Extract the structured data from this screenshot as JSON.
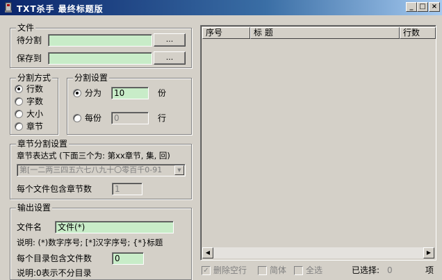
{
  "window": {
    "title": "TXT杀手  最终标题版",
    "minimize": "_",
    "maximize": "□",
    "close": "×"
  },
  "file": {
    "legend": "文件",
    "source_label": "待分割",
    "source_value": "",
    "save_label": "保存到",
    "save_value": "",
    "browse_label": "...",
    "browse2_label": "..."
  },
  "split_mode": {
    "legend": "分割方式",
    "options": [
      "行数",
      "字数",
      "大小",
      "章节"
    ],
    "selected": "行数"
  },
  "split_settings": {
    "legend": "分割设置",
    "parts_label": "分为",
    "parts_value": "10",
    "parts_unit": "份",
    "lines_label": "每份",
    "lines_value": "0",
    "lines_unit": "行"
  },
  "chapter": {
    "legend": "章节分割设置",
    "expr_label": "章节表达式 (下面三个为: 第xx章节, 集, 回)",
    "expr_value": "第[一二两三四五六七八九十〇零百千0-91",
    "per_file_label": "每个文件包含章节数",
    "per_file_value": "1"
  },
  "output": {
    "legend": "输出设置",
    "filename_label": "文件名",
    "filename_value": "文件(*)",
    "desc": "说明: (*)数字序号; [*]汉字序号; {*}标题",
    "per_dir_label": "每个目录包含文件数",
    "per_dir_value": "0",
    "per_dir_desc": "说明:0表示不分目录"
  },
  "list": {
    "columns": [
      "序号",
      "标      题",
      "行数"
    ]
  },
  "footer": {
    "delete_empty": "删除空行",
    "simplified": "简体",
    "select_all": "全选",
    "selected_label": "已选择:",
    "selected_count": "0",
    "unit": "项"
  }
}
